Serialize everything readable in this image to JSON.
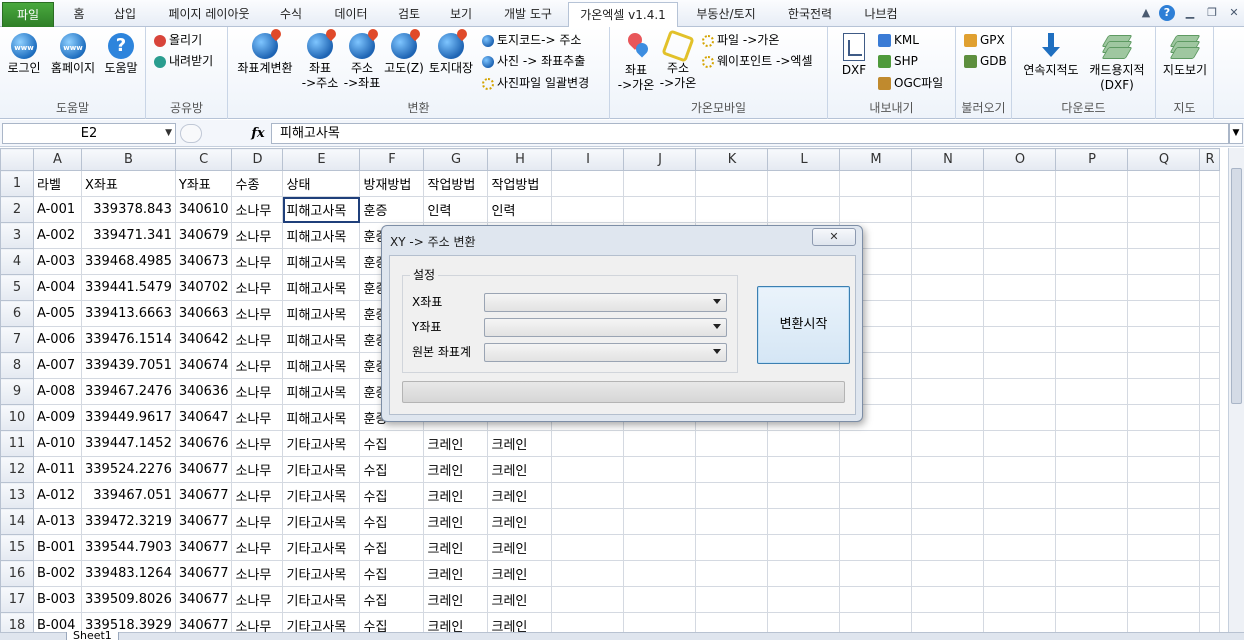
{
  "tabs": [
    "파일",
    "홈",
    "삽입",
    "페이지 레이아웃",
    "수식",
    "데이터",
    "검토",
    "보기",
    "개발 도구",
    "가온엑셀 v1.4.1",
    "부동산/토지",
    "한국전력",
    "나브컴"
  ],
  "ribbon": {
    "help": {
      "label": "도움말",
      "login": "로그인",
      "homepage": "홈페이지",
      "help_btn": "도움말"
    },
    "share": {
      "label": "공유방",
      "upload": "올리기",
      "download": "내려받기"
    },
    "convert": {
      "label": "변환",
      "coord_convert": "좌표계변환",
      "coord_to_addr_1": "좌표",
      "coord_to_addr_2": "->주소",
      "addr_to_coord_1": "주소",
      "addr_to_coord_2": "->좌표",
      "elevation": "고도(Z)",
      "land_register": "토지대장",
      "landcode_addr": "토지코드-> 주소",
      "photo_coord": "사진 -> 좌표추출",
      "photo_rename": "사진파일 일괄변경"
    },
    "mobile": {
      "label": "가온모바일",
      "coord_gaon_1": "좌표",
      "coord_gaon_2": "->가온",
      "addr_gaon_1": "주소",
      "addr_gaon_2": "->가온",
      "file_gaon": "파일 ->가온",
      "waypoint_excel": "웨이포인트 ->엑셀"
    },
    "export": {
      "label": "내보내기",
      "dxf": "DXF",
      "kml": "KML",
      "shp": "SHP",
      "ogc": "OGC파일"
    },
    "import": {
      "label": "불러오기",
      "gpx": "GPX",
      "gdb": "GDB"
    },
    "download": {
      "label": "다운로드",
      "cont_cadastral": "연속지적도",
      "cad_cadastral_1": "캐드용지적",
      "cad_cadastral_2": "(DXF)"
    },
    "map": {
      "label": "지도",
      "map_view": "지도보기"
    }
  },
  "formula_bar": {
    "name_box": "E2",
    "fx": "fx",
    "formula": "피해고사목"
  },
  "sheet": {
    "columns": [
      "A",
      "B",
      "C",
      "D",
      "E",
      "F",
      "G",
      "H",
      "I",
      "J",
      "K",
      "L",
      "M",
      "N",
      "O",
      "P",
      "Q",
      "R"
    ],
    "rows": [
      [
        "라벨",
        "X좌표",
        "Y좌표",
        "수종",
        "상태",
        "방재방법",
        "작업방법",
        "작업방법"
      ],
      [
        "A-001",
        "339378.843",
        "340610",
        "소나무",
        "피해고사목",
        "훈증",
        "인력",
        "인력"
      ],
      [
        "A-002",
        "339471.341",
        "340679",
        "소나무",
        "피해고사목",
        "훈증",
        "",
        ""
      ],
      [
        "A-003",
        "339468.4985",
        "340673",
        "소나무",
        "피해고사목",
        "훈증",
        "",
        ""
      ],
      [
        "A-004",
        "339441.5479",
        "340702",
        "소나무",
        "피해고사목",
        "훈증",
        "",
        ""
      ],
      [
        "A-005",
        "339413.6663",
        "340663",
        "소나무",
        "피해고사목",
        "훈증",
        "",
        ""
      ],
      [
        "A-006",
        "339476.1514",
        "340642",
        "소나무",
        "피해고사목",
        "훈증",
        "",
        ""
      ],
      [
        "A-007",
        "339439.7051",
        "340674",
        "소나무",
        "피해고사목",
        "훈증",
        "",
        ""
      ],
      [
        "A-008",
        "339467.2476",
        "340636",
        "소나무",
        "피해고사목",
        "훈증",
        "",
        ""
      ],
      [
        "A-009",
        "339449.9617",
        "340647",
        "소나무",
        "피해고사목",
        "훈증",
        "",
        ""
      ],
      [
        "A-010",
        "339447.1452",
        "340676",
        "소나무",
        "기타고사목",
        "수집",
        "크레인",
        "크레인"
      ],
      [
        "A-011",
        "339524.2276",
        "340677",
        "소나무",
        "기타고사목",
        "수집",
        "크레인",
        "크레인"
      ],
      [
        "A-012",
        "339467.051",
        "340677",
        "소나무",
        "기타고사목",
        "수집",
        "크레인",
        "크레인"
      ],
      [
        "A-013",
        "339472.3219",
        "340677",
        "소나무",
        "기타고사목",
        "수집",
        "크레인",
        "크레인"
      ],
      [
        "B-001",
        "339544.7903",
        "340677",
        "소나무",
        "기타고사목",
        "수집",
        "크레인",
        "크레인"
      ],
      [
        "B-002",
        "339483.1264",
        "340677",
        "소나무",
        "기타고사목",
        "수집",
        "크레인",
        "크레인"
      ],
      [
        "B-003",
        "339509.8026",
        "340677",
        "소나무",
        "기타고사목",
        "수집",
        "크레인",
        "크레인"
      ],
      [
        "B-004",
        "339518.3929",
        "340677",
        "소나무",
        "기타고사목",
        "수집",
        "크레인",
        "크레인"
      ]
    ],
    "sheet_tab": "Sheet1"
  },
  "dialog": {
    "title": "XY -> 주소 변환",
    "close": "✕",
    "group_label": "설정",
    "x_label": "X좌표",
    "y_label": "Y좌표",
    "crs_label": "원본 좌표계",
    "x_value": "",
    "y_value": "",
    "crs_value": "",
    "start_button": "변환시작"
  }
}
